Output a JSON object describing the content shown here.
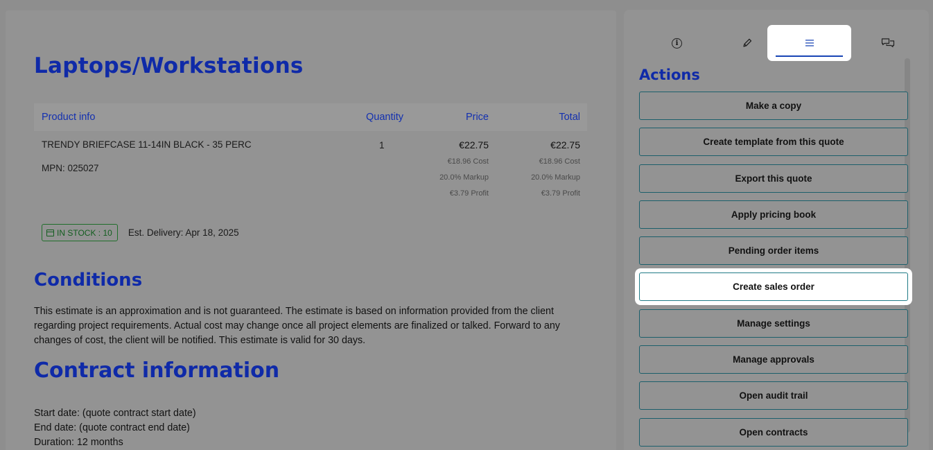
{
  "document": {
    "title": "Laptops/Workstations",
    "table": {
      "headers": {
        "info": "Product info",
        "quantity": "Quantity",
        "price": "Price",
        "total": "Total"
      },
      "row": {
        "name": "TRENDY BRIEFCASE 11-14IN BLACK - 35 PERC",
        "mpn": "MPN: 025027",
        "quantity": "1",
        "price": {
          "amount": "€22.75",
          "cost": "€18.96 Cost",
          "markup": "20.0% Markup",
          "profit": "€3.79 Profit"
        },
        "total": {
          "amount": "€22.75",
          "cost": "€18.96 Cost",
          "markup": "20.0% Markup",
          "profit": "€3.79 Profit"
        }
      }
    },
    "stock": {
      "badge": "IN STOCK : 10",
      "delivery": "Est. Delivery: Apr 18, 2025"
    },
    "conditions": {
      "title": "Conditions",
      "text": "This estimate is an approximation and is not guaranteed. The estimate is based on information provided from the client regarding project requirements. Actual cost may change once all project elements are finalized or talked. Forward to any changes of cost, the client will be notified. This estimate is valid for 30 days."
    },
    "contract": {
      "title": "Contract information",
      "start": "Start date: (quote contract start date)",
      "end": "End date: (quote contract end date)",
      "duration": "Duration: 12 months"
    }
  },
  "sidebar": {
    "tabs": [
      {
        "icon": "info-icon",
        "active": false
      },
      {
        "icon": "pencil-icon",
        "active": false
      },
      {
        "icon": "list-icon",
        "active": true
      },
      {
        "icon": "chat-icon",
        "active": false
      }
    ],
    "actions_title": "Actions",
    "actions": [
      "Make a copy",
      "Create template from this quote",
      "Export this quote",
      "Apply pricing book",
      "Pending order items",
      "Create sales order",
      "Manage settings",
      "Manage approvals",
      "Open audit trail",
      "Open contracts"
    ],
    "highlighted_action": "Create sales order"
  },
  "colors": {
    "heading": "#0f2aa8",
    "accent": "#1844b5",
    "stock": "#135d1f",
    "overlay": "#939393"
  }
}
